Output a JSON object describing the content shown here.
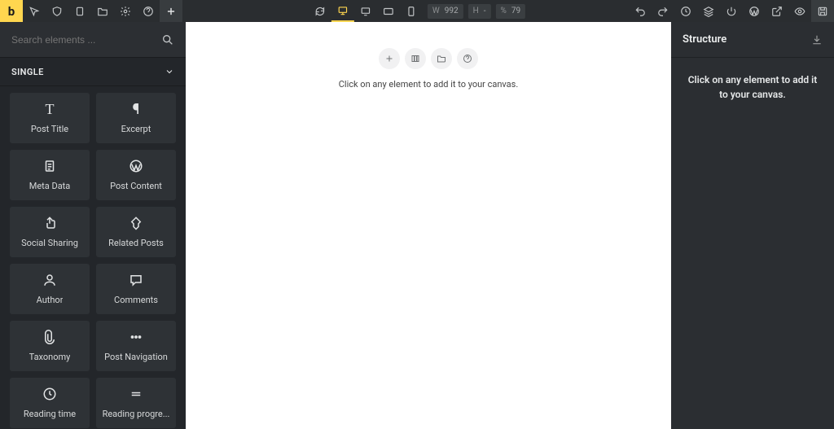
{
  "brand": "b",
  "search": {
    "placeholder": "Search elements ..."
  },
  "category": "SINGLE",
  "dims": {
    "wLabel": "W",
    "wVal": "992",
    "hLabel": "H",
    "hVal": "-",
    "pLabel": "%",
    "pVal": "79"
  },
  "elements": [
    {
      "label": "Post Title",
      "icon": "T"
    },
    {
      "label": "Excerpt",
      "icon": "pilcrow"
    },
    {
      "label": "Meta Data",
      "icon": "doc-lines"
    },
    {
      "label": "Post Content",
      "icon": "wp"
    },
    {
      "label": "Social Sharing",
      "icon": "share"
    },
    {
      "label": "Related Posts",
      "icon": "pin"
    },
    {
      "label": "Author",
      "icon": "user"
    },
    {
      "label": "Comments",
      "icon": "comment"
    },
    {
      "label": "Taxonomy",
      "icon": "clip"
    },
    {
      "label": "Post Navigation",
      "icon": "dots"
    },
    {
      "label": "Reading time",
      "icon": "clock"
    },
    {
      "label": "Reading progre...",
      "icon": "lines"
    }
  ],
  "canvas": {
    "hint": "Click on any element to add it to your canvas."
  },
  "structure": {
    "title": "Structure",
    "hint": "Click on any element to add it to your canvas."
  }
}
